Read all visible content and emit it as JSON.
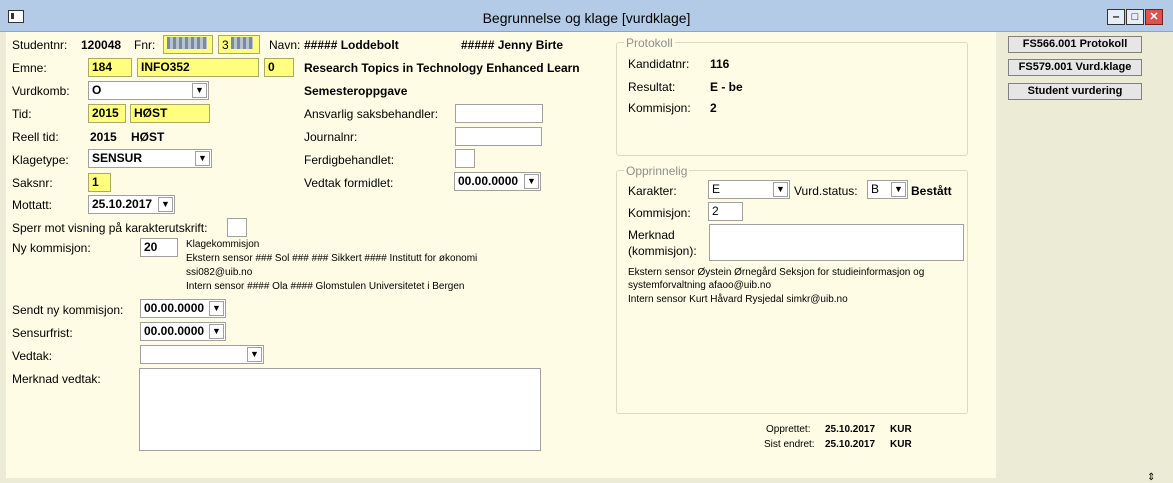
{
  "window": {
    "title": "Begrunnelse og klage [vurdklage]"
  },
  "student": {
    "studentnr_label": "Studentnr:",
    "studentnr": "120048",
    "fnr_label": "Fnr:",
    "fnr1": "",
    "fnr2": "3",
    "navn_label": "Navn:",
    "navn_last": "##### Loddebolt",
    "navn_first": "##### Jenny Birte"
  },
  "emne": {
    "label": "Emne:",
    "code1": "184",
    "code2": "INFO352",
    "code3": "0",
    "title": "Research Topics in Technology Enhanced Learn"
  },
  "vurdkomb": {
    "label": "Vurdkomb:",
    "value": "O",
    "name": "Semesteroppgave"
  },
  "tid": {
    "label": "Tid:",
    "year": "2015",
    "term": "HØST"
  },
  "reell_tid": {
    "label": "Reell tid:",
    "year": "2015",
    "term": "HØST"
  },
  "klagetype": {
    "label": "Klagetype:",
    "value": "SENSUR"
  },
  "saksnr": {
    "label": "Saksnr:",
    "value": "1"
  },
  "mottatt": {
    "label": "Mottatt:",
    "value": "25.10.2017"
  },
  "mid": {
    "ansvarlig_label": "Ansvarlig saksbehandler:",
    "ansvarlig": "",
    "journalnr_label": "Journalnr:",
    "journalnr": "",
    "ferdig_label": "Ferdigbehandlet:",
    "vedtak_formidlet_label": "Vedtak formidlet:",
    "vedtak_formidlet": "00.00.0000"
  },
  "sperr": {
    "label": "Sperr mot visning på karakterutskrift:"
  },
  "ny_kommisjon": {
    "label": "Ny kommisjon:",
    "value": "20",
    "lines": [
      "Klagekommisjon",
      "Ekstern sensor ### Sol ### ### Sikkert #### Institutt for økonomi",
      "ssi082@uib.no",
      "Intern sensor #### Ola #### Glomstulen Universitetet i Bergen"
    ]
  },
  "sendt": {
    "label": "Sendt ny kommisjon:",
    "value": "00.00.0000"
  },
  "sensurfrist": {
    "label": "Sensurfrist:",
    "value": "00.00.0000"
  },
  "vedtak": {
    "label": "Vedtak:",
    "value": ""
  },
  "merknad_vedtak": {
    "label": "Merknad vedtak:",
    "value": ""
  },
  "protokoll": {
    "title": "Protokoll",
    "kandidatnr_label": "Kandidatnr:",
    "kandidatnr": "116",
    "resultat_label": "Resultat:",
    "resultat": "E - be",
    "kommisjon_label": "Kommisjon:",
    "kommisjon": "2"
  },
  "opprinnelig": {
    "title": "Opprinnelig",
    "karakter_label": "Karakter:",
    "karakter": "E",
    "vurdstatus_label": "Vurd.status:",
    "vurdstatus": "B",
    "vurdstatus_text": "Bestått",
    "kommisjon_label": "Kommisjon:",
    "kommisjon": "2",
    "merknad_label1": "Merknad",
    "merknad_label2": "(kommisjon):",
    "merknad": "",
    "sensor_lines": [
      "Ekstern sensor Øystein Ørnegård Seksjon for studieinformasjon og",
      "systemforvaltning afaoo@uib.no",
      "Intern sensor Kurt Håvard Rysjedal  simkr@uib.no"
    ]
  },
  "footer": {
    "opprettet_label": "Opprettet:",
    "opprettet_date": "25.10.2017",
    "opprettet_user": "KUR",
    "endret_label": "Sist endret:",
    "endret_date": "25.10.2017",
    "endret_user": "KUR"
  },
  "buttons": {
    "protokoll": "FS566.001 Protokoll",
    "vurdklage": "FS579.001 Vurd.klage",
    "student_vurdering": "Student vurdering"
  }
}
